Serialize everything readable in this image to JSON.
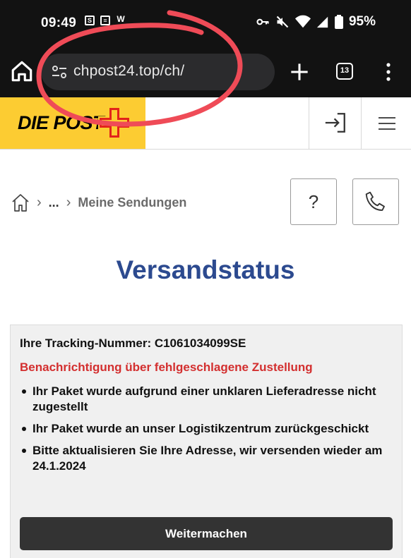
{
  "status_bar": {
    "time": "09:49",
    "notif_1": "S",
    "notif_2": "≡",
    "notif_3": "W",
    "battery": "95%"
  },
  "browser": {
    "url": "chpost24.top/ch/",
    "tab_count": "13"
  },
  "site": {
    "logo": "DIE POST",
    "accent_yellow": "#fccc32",
    "accent_red": "#e2231a"
  },
  "breadcrumb": {
    "ellipsis": "...",
    "current": "Meine Sendungen"
  },
  "help_label": "?",
  "page_title": "Versandstatus",
  "card": {
    "tracking": "Ihre Tracking-Nummer: C1061034099SE",
    "alert": "Benachrichtigung über fehlgeschlagene Zustellung",
    "bullets": [
      "Ihr Paket wurde aufgrund einer unklaren Lieferadresse nicht zugestellt",
      "Ihr Paket wurde an unser Logistikzentrum zurückgeschickt",
      "Bitte aktualisieren Sie Ihre Adresse, wir versenden wieder am 24.1.2024"
    ],
    "button": "Weitermachen"
  }
}
